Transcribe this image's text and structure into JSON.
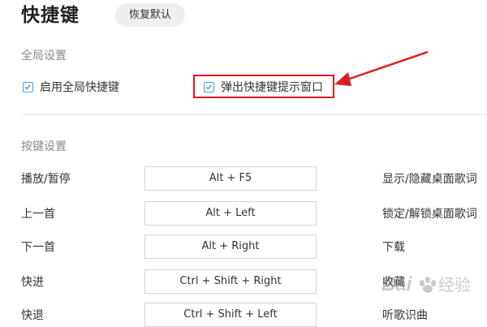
{
  "header": {
    "title": "快捷键",
    "reset_label": "恢复默认"
  },
  "global_settings": {
    "title": "全局设置",
    "enable_global": {
      "label": "启用全局快捷键",
      "checked": true
    },
    "show_tip": {
      "label": "弹出快捷键提示窗口",
      "checked": true
    }
  },
  "key_settings": {
    "title": "按键设置",
    "rows": [
      {
        "label": "播放/暂停",
        "value": "Alt + F5",
        "right_label": "显示/隐藏桌面歌词"
      },
      {
        "label": "上一首",
        "value": "Alt + Left",
        "right_label": "锁定/解锁桌面歌词"
      },
      {
        "label": "下一首",
        "value": "Alt + Right",
        "right_label": "下载"
      },
      {
        "label": "快进",
        "value": "Ctrl + Shift + Right",
        "right_label": "收藏"
      },
      {
        "label": "快退",
        "value": "Ctrl + Shift + Left",
        "right_label": "听歌识曲"
      }
    ]
  },
  "annotation": {
    "color": "#e11b22"
  },
  "colors": {
    "checkbox": "#4a9ad8",
    "button_bg": "#efefef"
  },
  "watermark": {
    "text": "Bai 经验"
  }
}
